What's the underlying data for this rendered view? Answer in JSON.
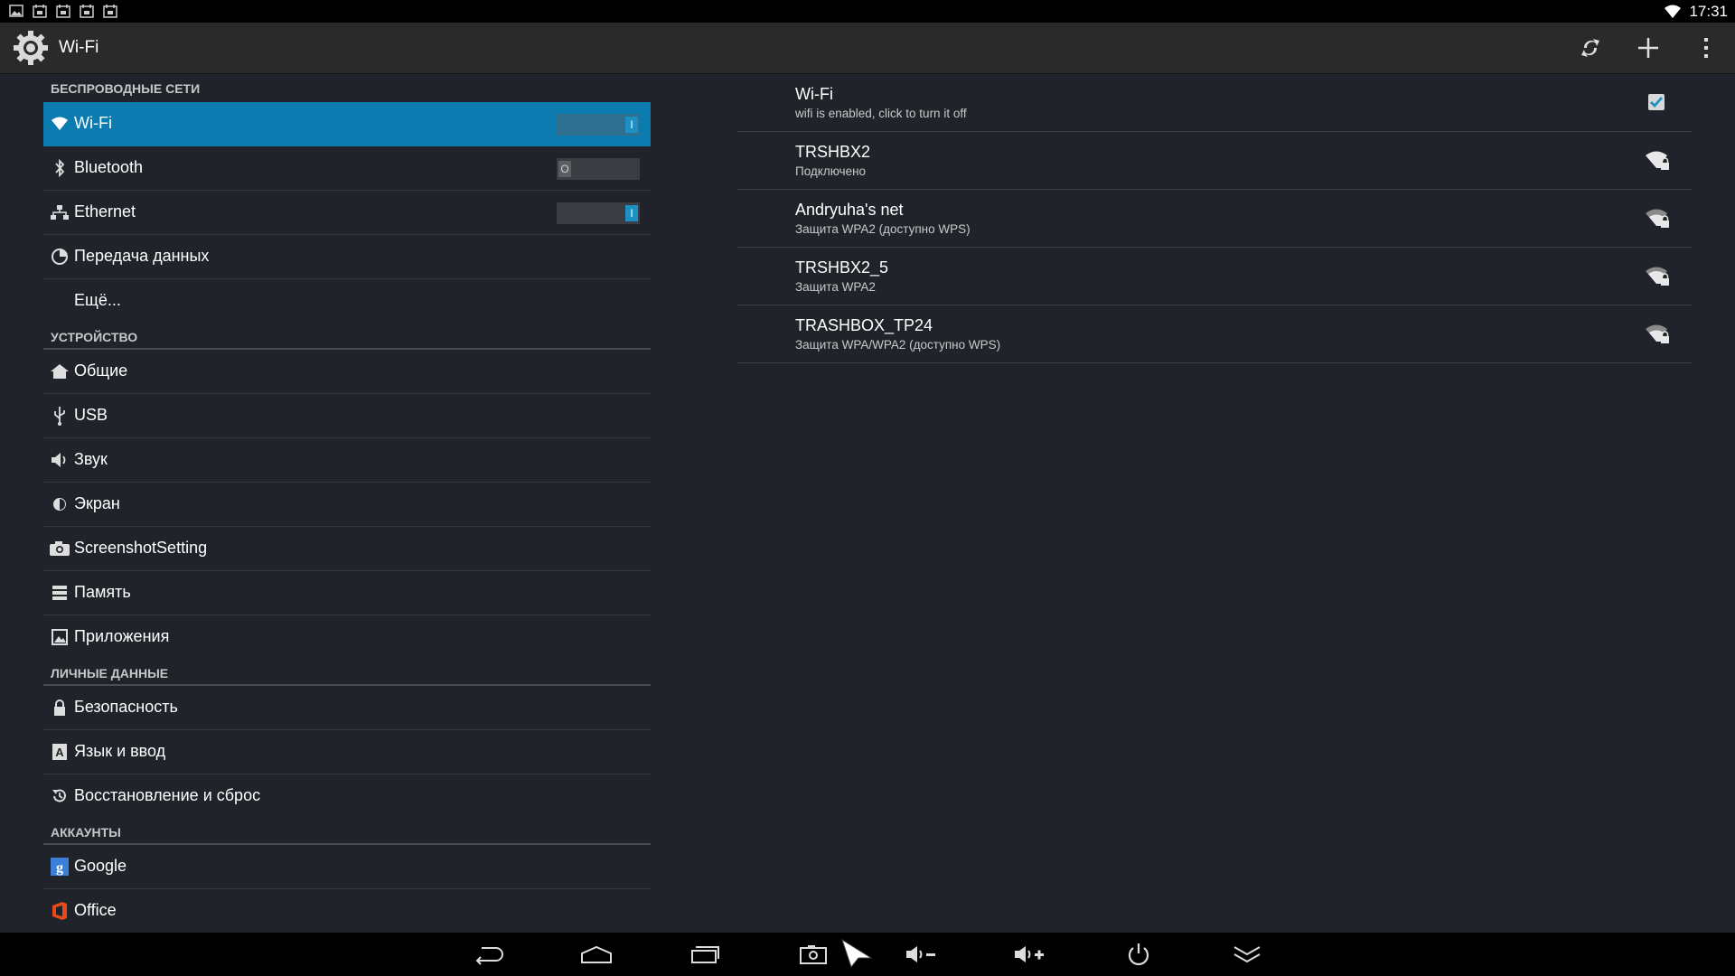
{
  "status_bar": {
    "clock": "17:31",
    "notification_icons": [
      "image-icon",
      "calendar-icon",
      "calendar-icon",
      "calendar-icon",
      "calendar-icon"
    ],
    "wifi_icon": "wifi-signal-icon"
  },
  "action_bar": {
    "title": "Wi-Fi",
    "app_icon": "settings-gear-icon",
    "actions": [
      "wps-icon",
      "add-network-icon",
      "overflow-menu-icon"
    ]
  },
  "settings_menu": {
    "sections": [
      {
        "header": "БЕСПРОВОДНЫЕ СЕТИ",
        "items": [
          {
            "label": "Wi-Fi",
            "icon": "wifi-icon",
            "toggle": "I",
            "selected": true
          },
          {
            "label": "Bluetooth",
            "icon": "bluetooth-icon",
            "toggle": "O"
          },
          {
            "label": "Ethernet",
            "icon": "ethernet-icon",
            "toggle": "I"
          },
          {
            "label": "Передача данных",
            "icon": "data-usage-icon"
          },
          {
            "label": "Ещё...",
            "icon": ""
          }
        ]
      },
      {
        "header": "УСТРОЙСТВО",
        "items": [
          {
            "label": "Общие",
            "icon": "home-icon"
          },
          {
            "label": "USB",
            "icon": "usb-icon"
          },
          {
            "label": "Звук",
            "icon": "sound-icon"
          },
          {
            "label": "Экран",
            "icon": "display-icon"
          },
          {
            "label": "ScreenshotSetting",
            "icon": "camera-icon"
          },
          {
            "label": "Память",
            "icon": "storage-icon"
          },
          {
            "label": "Приложения",
            "icon": "apps-icon"
          }
        ]
      },
      {
        "header": "ЛИЧНЫЕ ДАННЫЕ",
        "items": [
          {
            "label": "Безопасность",
            "icon": "lock-icon"
          },
          {
            "label": "Язык и ввод",
            "icon": "language-icon"
          },
          {
            "label": "Восстановление и сброс",
            "icon": "backup-icon"
          }
        ]
      },
      {
        "header": "АККАУНТЫ",
        "items": [
          {
            "label": "Google",
            "icon": "google-icon"
          },
          {
            "label": "Office",
            "icon": "office-icon"
          }
        ]
      }
    ]
  },
  "wifi_panel": {
    "master": {
      "title": "Wi-Fi",
      "summary": "wifi is enabled, click to turn it off",
      "checked": true
    },
    "networks": [
      {
        "ssid": "TRSHBX2",
        "status": "Подключено",
        "icon": "wifi-lock-icon"
      },
      {
        "ssid": "Andryuha's net",
        "status": "Защита WPA2 (доступно WPS)",
        "icon": "wifi-lock-icon"
      },
      {
        "ssid": "TRSHBX2_5",
        "status": "Защита WPA2",
        "icon": "wifi-lock-icon"
      },
      {
        "ssid": "TRASHBOX_TP24",
        "status": "Защита WPA/WPA2 (доступно WPS)",
        "icon": "wifi-lock-icon"
      }
    ]
  },
  "nav_bar": {
    "buttons": [
      "back-icon",
      "home-icon",
      "recents-icon",
      "screenshot-icon",
      "volume-down-icon",
      "volume-up-icon",
      "power-icon",
      "collapse-icon"
    ]
  },
  "colors": {
    "accent": "#0b7bb0",
    "background": "#20242a",
    "toggle_on": "#1c8fc4"
  }
}
